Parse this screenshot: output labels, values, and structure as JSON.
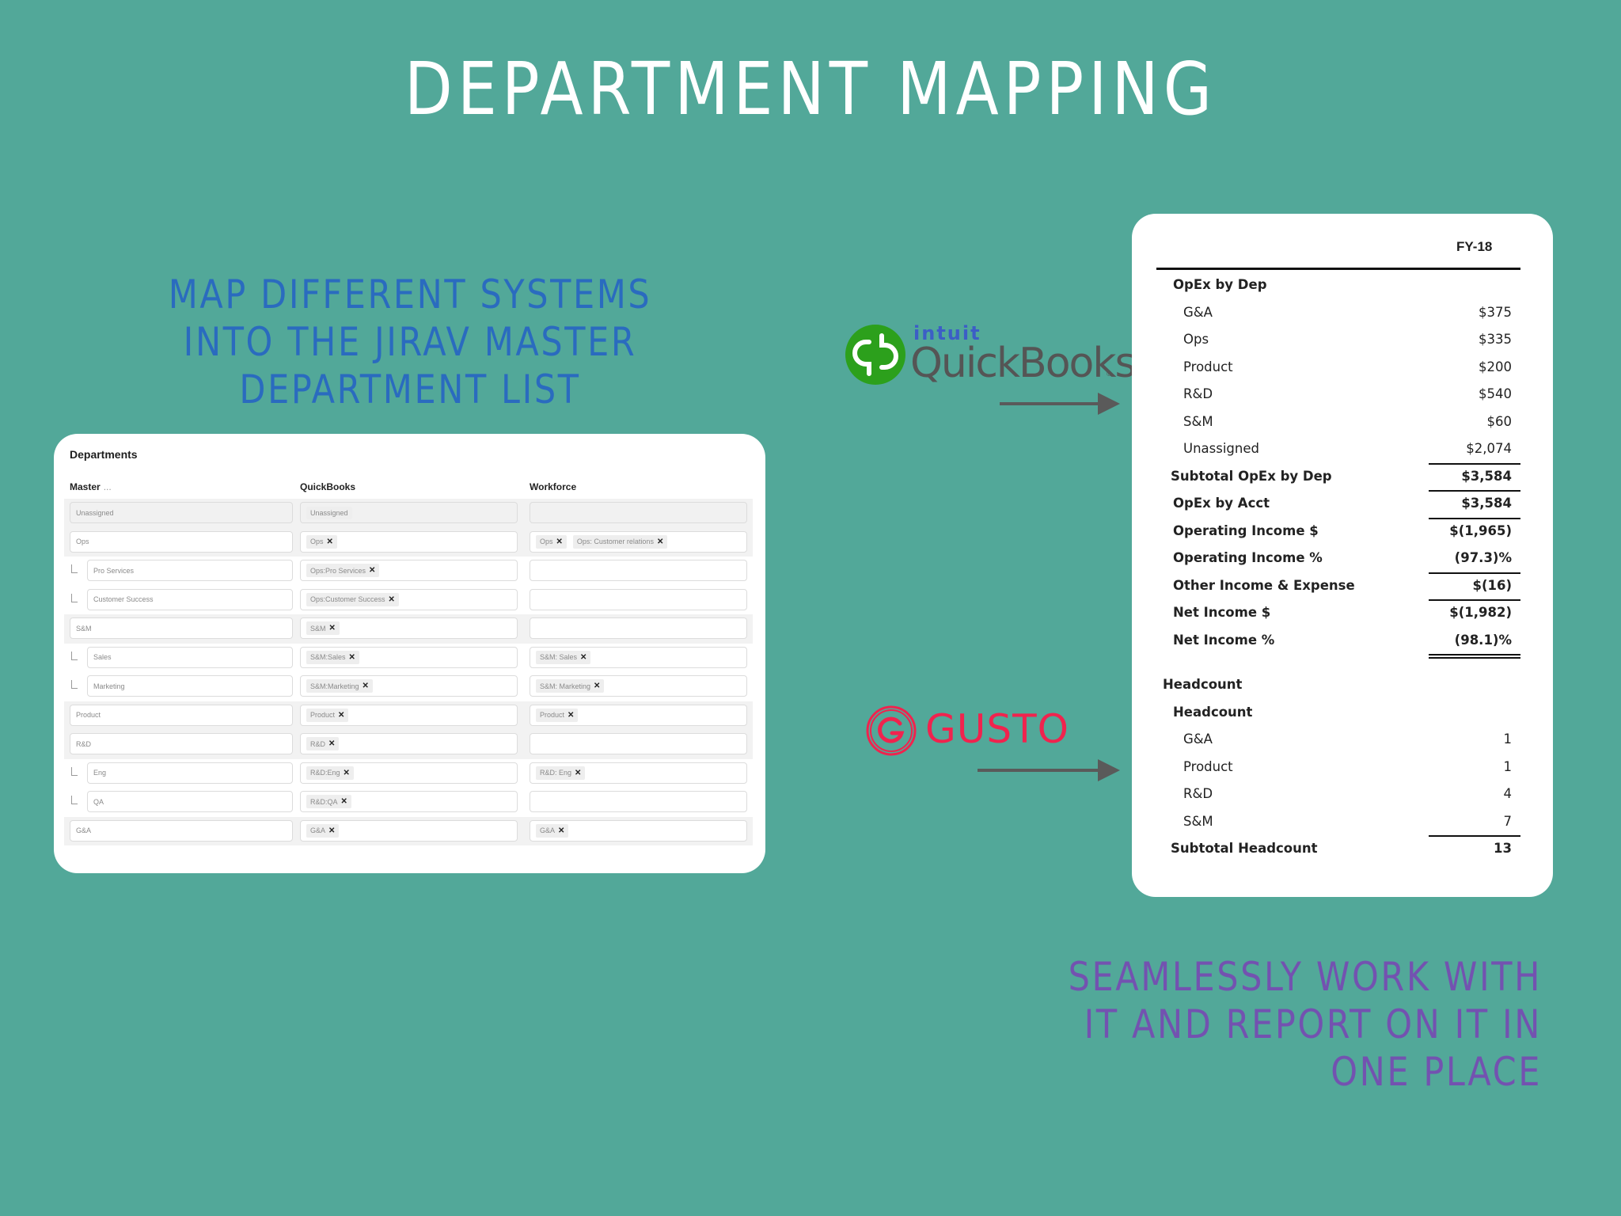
{
  "title": "DEPARTMENT MAPPING",
  "left_subtitle": [
    "MAP DIFFERENT SYSTEMS",
    "INTO THE JIRAV MASTER",
    "DEPARTMENT LIST"
  ],
  "right_subtitle": [
    "SEAMLESSLY WORK WITH",
    "IT AND REPORT ON IT IN",
    "ONE PLACE"
  ],
  "colors": {
    "background": "#52a899",
    "title": "#ffffff",
    "left_subtitle": "#2a6bbf",
    "right_subtitle": "#7352b0",
    "quickbooks_green": "#2ca01c",
    "intuit_blue": "#3c5ec6",
    "gusto_red": "#f0234e"
  },
  "logos": {
    "quickbooks": {
      "brand": "intuit",
      "name": "QuickBooks",
      "reg": "®"
    },
    "gusto": {
      "name": "GUSTO"
    }
  },
  "departments": {
    "title": "Departments",
    "columns": {
      "master": "Master",
      "master_more": "...",
      "quickbooks": "QuickBooks",
      "workforce": "Workforce"
    },
    "rows": [
      {
        "master": "Unassigned",
        "child": false,
        "shaded": true,
        "disabled": true,
        "quickbooks": [
          {
            "label": "Unassigned",
            "removable": false
          }
        ],
        "workforce": []
      },
      {
        "master": "Ops",
        "child": false,
        "shaded": true,
        "disabled": false,
        "quickbooks": [
          {
            "label": "Ops",
            "removable": true
          }
        ],
        "workforce": [
          {
            "label": "Ops",
            "removable": true
          },
          {
            "label": "Ops: Customer relations",
            "removable": true
          }
        ]
      },
      {
        "master": "Pro Services",
        "child": true,
        "shaded": false,
        "disabled": false,
        "quickbooks": [
          {
            "label": "Ops:Pro Services",
            "removable": true
          }
        ],
        "workforce": []
      },
      {
        "master": "Customer Success",
        "child": true,
        "shaded": false,
        "disabled": false,
        "quickbooks": [
          {
            "label": "Ops:Customer Success",
            "removable": true
          }
        ],
        "workforce": []
      },
      {
        "master": "S&M",
        "child": false,
        "shaded": true,
        "disabled": false,
        "quickbooks": [
          {
            "label": "S&M",
            "removable": true
          }
        ],
        "workforce": []
      },
      {
        "master": "Sales",
        "child": true,
        "shaded": false,
        "disabled": false,
        "quickbooks": [
          {
            "label": "S&M:Sales",
            "removable": true
          }
        ],
        "workforce": [
          {
            "label": "S&M: Sales",
            "removable": true
          }
        ]
      },
      {
        "master": "Marketing",
        "child": true,
        "shaded": false,
        "disabled": false,
        "quickbooks": [
          {
            "label": "S&M:Marketing",
            "removable": true
          }
        ],
        "workforce": [
          {
            "label": "S&M: Marketing",
            "removable": true
          }
        ]
      },
      {
        "master": "Product",
        "child": false,
        "shaded": true,
        "disabled": false,
        "quickbooks": [
          {
            "label": "Product",
            "removable": true
          }
        ],
        "workforce": [
          {
            "label": "Product",
            "removable": true
          }
        ]
      },
      {
        "master": "R&D",
        "child": false,
        "shaded": true,
        "disabled": false,
        "quickbooks": [
          {
            "label": "R&D",
            "removable": true
          }
        ],
        "workforce": []
      },
      {
        "master": "Eng",
        "child": true,
        "shaded": false,
        "disabled": false,
        "quickbooks": [
          {
            "label": "R&D:Eng",
            "removable": true
          }
        ],
        "workforce": [
          {
            "label": "R&D: Eng",
            "removable": true
          }
        ]
      },
      {
        "master": "QA",
        "child": true,
        "shaded": false,
        "disabled": false,
        "quickbooks": [
          {
            "label": "R&D:QA",
            "removable": true
          }
        ],
        "workforce": []
      },
      {
        "master": "G&A",
        "child": false,
        "shaded": true,
        "disabled": false,
        "quickbooks": [
          {
            "label": "G&A",
            "removable": true
          }
        ],
        "workforce": [
          {
            "label": "G&A",
            "removable": true
          }
        ]
      }
    ]
  },
  "report": {
    "column_header": "FY-18",
    "rows": [
      {
        "label": "OpEx by Dep",
        "value": "",
        "bold": true,
        "indent": "l1"
      },
      {
        "label": "G&A",
        "value": "$375",
        "bold": false,
        "indent": "l2"
      },
      {
        "label": "Ops",
        "value": "$335",
        "bold": false,
        "indent": "l2"
      },
      {
        "label": "Product",
        "value": "$200",
        "bold": false,
        "indent": "l2"
      },
      {
        "label": "R&D",
        "value": "$540",
        "bold": false,
        "indent": "l2"
      },
      {
        "label": "S&M",
        "value": "$60",
        "bold": false,
        "indent": "l2"
      },
      {
        "label": "Unassigned",
        "value": "$2,074",
        "bold": false,
        "indent": "l2",
        "rule_below": "single"
      },
      {
        "label": "Subtotal OpEx by Dep",
        "value": "$3,584",
        "bold": true,
        "indent": "l1s",
        "rule_below": "single"
      },
      {
        "label": "OpEx by Acct",
        "value": "$3,584",
        "bold": true,
        "indent": "l1",
        "rule_below": "single"
      },
      {
        "label": "Operating Income $",
        "value": "$(1,965)",
        "bold": true,
        "indent": "l1"
      },
      {
        "label": "Operating Income %",
        "value": "(97.3)%",
        "bold": true,
        "indent": "l1",
        "rule_below": "single"
      },
      {
        "label": "Other Income & Expense",
        "value": "$(16)",
        "bold": true,
        "indent": "l1",
        "rule_below": "single"
      },
      {
        "label": "Net Income $",
        "value": "$(1,982)",
        "bold": true,
        "indent": "l1"
      },
      {
        "label": "Net Income %",
        "value": "(98.1)%",
        "bold": true,
        "indent": "l1",
        "rule_below": "double"
      },
      {
        "label": "",
        "value": "",
        "bold": false,
        "indent": "l0",
        "spacer": true
      },
      {
        "label": "Headcount",
        "value": "",
        "bold": true,
        "indent": "l0"
      },
      {
        "label": "Headcount",
        "value": "",
        "bold": true,
        "indent": "l1"
      },
      {
        "label": "G&A",
        "value": "1",
        "bold": false,
        "indent": "l2"
      },
      {
        "label": "Product",
        "value": "1",
        "bold": false,
        "indent": "l2"
      },
      {
        "label": "R&D",
        "value": "4",
        "bold": false,
        "indent": "l2"
      },
      {
        "label": "S&M",
        "value": "7",
        "bold": false,
        "indent": "l2",
        "rule_below": "single"
      },
      {
        "label": "Subtotal Headcount",
        "value": "13",
        "bold": true,
        "indent": "l1s"
      }
    ]
  }
}
